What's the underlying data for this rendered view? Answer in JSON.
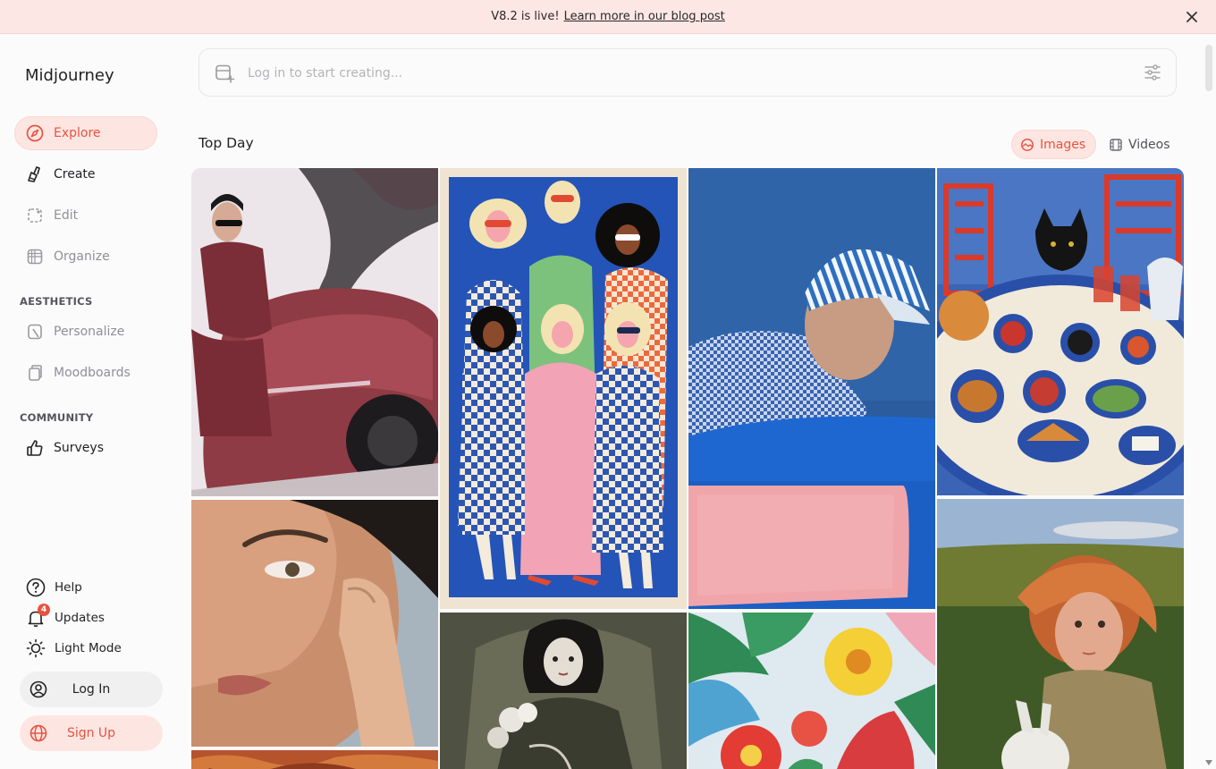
{
  "banner": {
    "message": "V8.2 is live!",
    "link_text": "Learn more in our blog post"
  },
  "sidebar": {
    "brand": "Midjourney",
    "nav": [
      {
        "label": "Explore",
        "icon": "compass-icon"
      },
      {
        "label": "Create",
        "icon": "brush-icon"
      },
      {
        "label": "Edit",
        "icon": "edit-frame-icon"
      },
      {
        "label": "Organize",
        "icon": "grid-icon"
      }
    ],
    "aesthetics_label": "AESTHETICS",
    "aesthetics": [
      {
        "label": "Personalize",
        "icon": "personalize-icon"
      },
      {
        "label": "Moodboards",
        "icon": "moodboard-icon"
      }
    ],
    "community_label": "COMMUNITY",
    "community": [
      {
        "label": "Surveys",
        "icon": "thumbs-up-icon"
      }
    ],
    "bottom": [
      {
        "label": "Help",
        "icon": "help-icon"
      },
      {
        "label": "Updates",
        "icon": "bell-icon",
        "badge": "4"
      },
      {
        "label": "Light Mode",
        "icon": "sun-icon"
      }
    ],
    "login_label": "Log In",
    "signup_label": "Sign Up"
  },
  "prompt": {
    "placeholder": "Log in to start creating..."
  },
  "feed": {
    "title": "Top Day",
    "tabs": [
      {
        "label": "Images",
        "icon": "image-icon"
      },
      {
        "label": "Videos",
        "icon": "film-icon"
      }
    ],
    "images": [
      "red-car-fashion-photo",
      "checkered-women-illustration",
      "striped-cap-man-photo",
      "cat-table-food-painting",
      "skin-closeup-portrait",
      "sepia-woman-portrait",
      "tropical-flowers-painting",
      "red-haired-child-rabbit-photo",
      "autumn-leaves-image"
    ]
  },
  "colors": {
    "accent": "#e8523f",
    "accent_bg": "#fde6e2",
    "banner_bg": "#fde7e4"
  }
}
